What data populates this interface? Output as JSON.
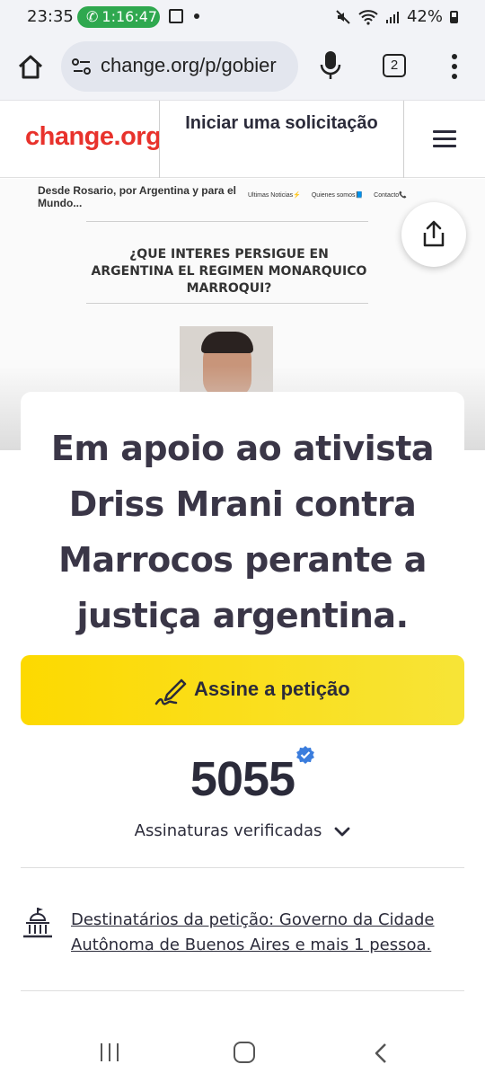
{
  "status_bar": {
    "time": "23:35",
    "call_timer": "1:16:47",
    "battery": "42%"
  },
  "browser": {
    "url": "change.org/p/gobier",
    "tab_count": "2"
  },
  "header": {
    "logo": "change.org",
    "start_petition": "Iniciar uma solicitação"
  },
  "hero": {
    "blog_name": "Desde Rosario, por Argentina y para el Mundo...",
    "nav_items": [
      "Ultimas Noticias⚡",
      "Quienes somos📘",
      "Contacto📞"
    ],
    "article_title": "¿QUE INTERES PERSIGUE EN ARGENTINA EL REGIMEN MONARQUICO MARROQUI?"
  },
  "petition": {
    "title": "Em apoio ao ativista Driss Mrani contra Marrocos perante a justiça argentina.",
    "sign_label": "Assine a petição",
    "signature_count": "5055",
    "verified_label": "Assinaturas verificadas",
    "recipients": "Destinatários da petição: Governo da Cidade Autônoma de Buenos Aires e mais 1 pessoa."
  },
  "colors": {
    "brand_red": "#e8322c",
    "sign_yellow": "#fdd900",
    "verified_blue": "#3b7ddd",
    "call_green": "#2fa84f"
  },
  "icons": [
    "phone-icon",
    "gallery-icon",
    "mute-icon",
    "wifi-icon",
    "signal-icon",
    "battery-icon",
    "home-icon",
    "site-settings-icon",
    "mic-icon",
    "tabs-icon",
    "more-icon",
    "hamburger-icon",
    "share-icon",
    "pen-signature-icon",
    "verified-badge-icon",
    "chevron-down-icon",
    "capitol-icon",
    "recent-apps-icon",
    "nav-home-icon",
    "back-icon"
  ]
}
